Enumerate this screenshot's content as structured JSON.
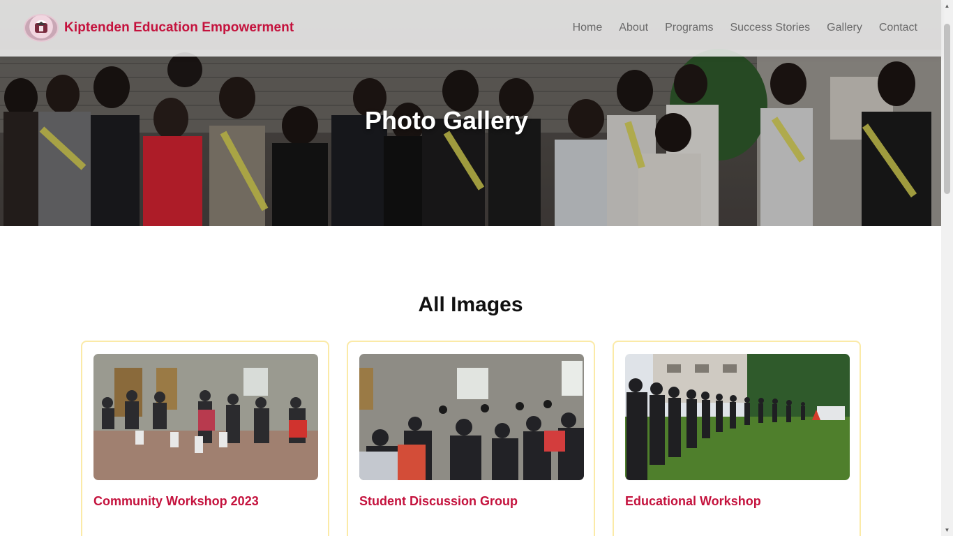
{
  "header": {
    "brand_name": "Kiptenden Education Empowerment",
    "nav": [
      "Home",
      "About",
      "Programs",
      "Success Stories",
      "Gallery",
      "Contact"
    ]
  },
  "hero": {
    "title": "Photo Gallery"
  },
  "gallery": {
    "title": "All Images",
    "items": [
      {
        "caption": "Community Workshop 2023"
      },
      {
        "caption": "Student Discussion Group"
      },
      {
        "caption": "Educational Workshop"
      }
    ]
  },
  "colors": {
    "brand": "#c4123d",
    "card_border": "#fbeaa7",
    "nav_text": "#6a6a6a"
  }
}
